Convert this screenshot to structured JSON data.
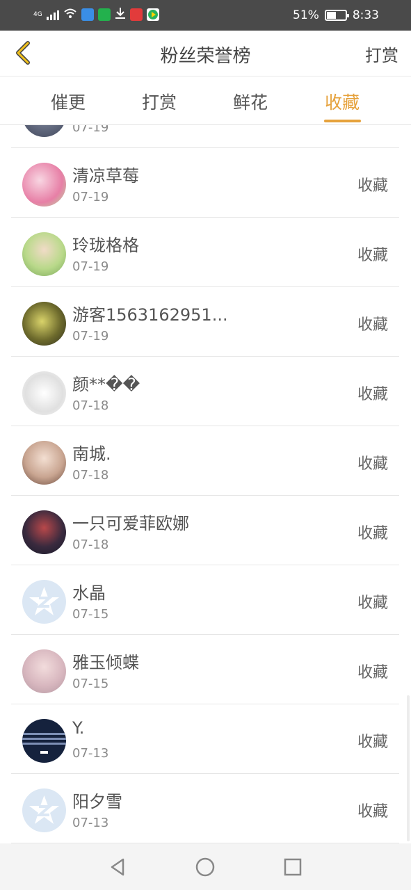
{
  "status_bar": {
    "signal_label": "4G",
    "battery_percent_text": "51%",
    "battery_level": 0.51,
    "time": "8:33"
  },
  "header": {
    "title": "粉丝荣誉榜",
    "action_label": "打赏"
  },
  "tabs": [
    {
      "label": "催更"
    },
    {
      "label": "打赏"
    },
    {
      "label": "鲜花"
    },
    {
      "label": "收藏"
    }
  ],
  "active_tab": "收藏",
  "list": {
    "partial_row_date": "07-19",
    "items": [
      {
        "name": "清凉草莓",
        "date": "07-19",
        "action": "收藏"
      },
      {
        "name": "玲珑格格",
        "date": "07-19",
        "action": "收藏"
      },
      {
        "name": "游客1563162951...",
        "date": "07-19",
        "action": "收藏"
      },
      {
        "name": "颜**��",
        "date": "07-18",
        "action": "收藏"
      },
      {
        "name": "南城.",
        "date": "07-18",
        "action": "收藏"
      },
      {
        "name": "一只可爱菲欧娜",
        "date": "07-18",
        "action": "收藏"
      },
      {
        "name": "水晶",
        "date": "07-15",
        "action": "收藏"
      },
      {
        "name": "雅玉倾蝶",
        "date": "07-15",
        "action": "收藏"
      },
      {
        "name": "Y.",
        "date": "07-13",
        "action": "收藏"
      },
      {
        "name": "阳夕雪",
        "date": "07-13",
        "action": "收藏"
      }
    ]
  },
  "colors": {
    "accent": "#e6a23c",
    "status_bar_bg": "#4a4a4a",
    "text": "#555555",
    "date_text": "#8a8a8a"
  }
}
